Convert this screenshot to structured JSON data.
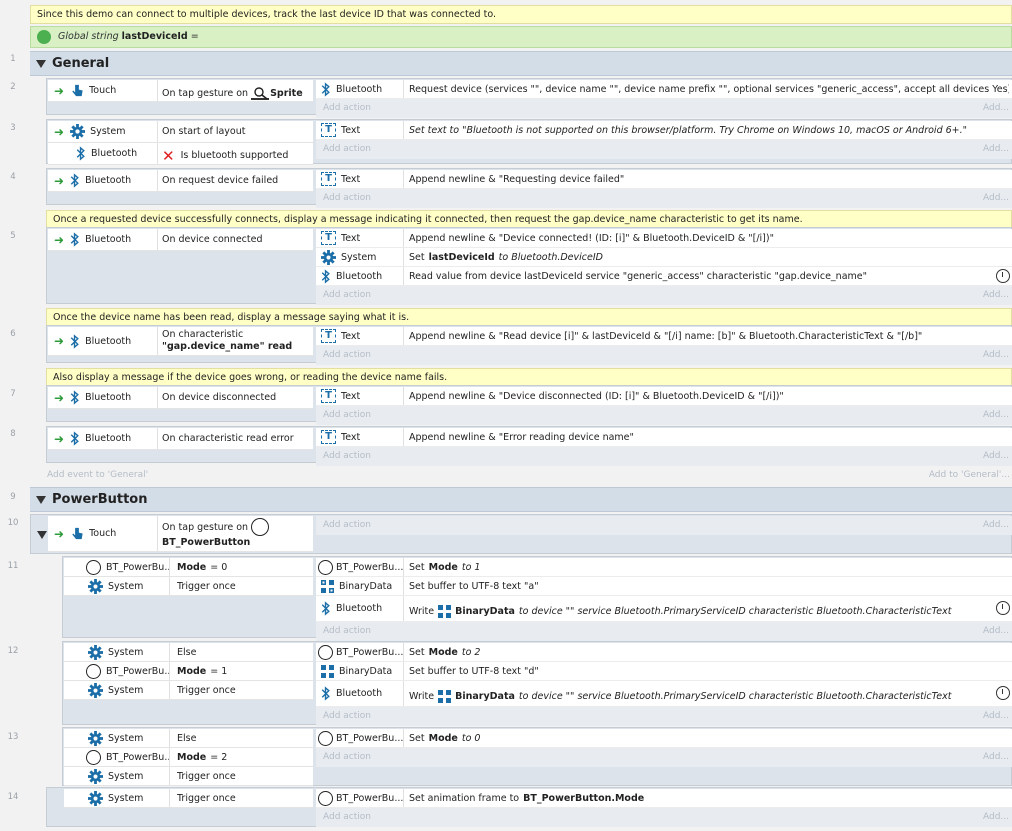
{
  "comments": {
    "c0": "Since this demo can connect to multiple devices, track the last device ID that was connected to.",
    "c5": "Once a requested device successfully connects, display a message indicating it connected, then request the gap.device_name characteristic to get its name.",
    "c6": "Once the device name has been read, display a message saying what it is.",
    "c7": "Also display a message if the device goes wrong, or reading the device name fails."
  },
  "global_var": {
    "prefix": "Global string",
    "name": "lastDeviceId",
    "suffix": "="
  },
  "line_numbers": [
    "1",
    "2",
    "3",
    "4",
    "5",
    "6",
    "7",
    "8",
    "9",
    "10",
    "11",
    "12",
    "13",
    "14"
  ],
  "groups": {
    "general": "General",
    "power": "PowerButton"
  },
  "objects": {
    "touch": "Touch",
    "bluetooth": "Bluetooth",
    "system": "System",
    "text": "Text",
    "bt_power": "BT_PowerBu...",
    "binary": "BinaryData"
  },
  "add_action": "Add action",
  "add_more": "Add...",
  "add_event": "Add event to 'General'",
  "add_to": "Add to 'General'...",
  "events": {
    "e2": {
      "cond": "On tap gesture on",
      "cond_obj": "Sprite",
      "action": "Request device (services \"\", device name \"\", device name prefix \"\", optional services \"generic_access\", accept all devices Yes)"
    },
    "e3": {
      "cond1": "On start of layout",
      "cond2": "Is bluetooth supported",
      "action": "Set text to \"Bluetooth is not supported on this browser/platform. Try Chrome on Windows 10, macOS or Android 6+.\""
    },
    "e4": {
      "cond": "On request device failed",
      "action": "Append newline & \"Requesting device failed\""
    },
    "e5": {
      "cond": "On device connected",
      "a1": "Append newline & \"Device connected! (ID: [i]\" & Bluetooth.DeviceID & \"[/i])\"",
      "a2_pre": "Set",
      "a2_var": "lastDeviceId",
      "a2_post": "to Bluetooth.DeviceID",
      "a3": "Read value from device lastDeviceId service \"generic_access\" characteristic \"gap.device_name\""
    },
    "e6": {
      "cond_a": "On characteristic",
      "cond_b": "\"gap.device_name\" read",
      "action": "Append newline & \"Read device [i]\" & lastDeviceId & \"[/i] name: [b]\" & Bluetooth.CharacteristicText & \"[/b]\""
    },
    "e7": {
      "cond": "On device disconnected",
      "action": "Append newline & \"Device disconnected (ID: [i]\" & Bluetooth.DeviceID & \"[/i])\""
    },
    "e8": {
      "cond": "On characteristic read error",
      "action": "Append newline & \"Error reading device name\""
    },
    "e10": {
      "cond_a": "On tap gesture on",
      "cond_b": "BT_PowerButton"
    },
    "e11": {
      "c1_var": "Mode",
      "c1_val": "= 0",
      "c2": "Trigger once",
      "a1_pre": "Set",
      "a1_var": "Mode",
      "a1_post": "to 1",
      "a2": "Set buffer to UTF-8 text \"a\"",
      "a3_pre": "Write",
      "a3_obj": "BinaryData",
      "a3_post": "to device \"\" service Bluetooth.PrimaryServiceID characteristic Bluetooth.CharacteristicText"
    },
    "e12": {
      "c1": "Else",
      "c2_var": "Mode",
      "c2_val": "= 1",
      "c3": "Trigger once",
      "a1_pre": "Set",
      "a1_var": "Mode",
      "a1_post": "to 2",
      "a2": "Set buffer to UTF-8 text \"d\"",
      "a3_pre": "Write",
      "a3_obj": "BinaryData",
      "a3_post": "to device \"\" service Bluetooth.PrimaryServiceID characteristic Bluetooth.CharacteristicText"
    },
    "e13": {
      "c1": "Else",
      "c2_var": "Mode",
      "c2_val": "= 2",
      "c3": "Trigger once",
      "a1_pre": "Set",
      "a1_var": "Mode",
      "a1_post": "to 0"
    },
    "e14": {
      "cond": "Trigger once",
      "a_pre": "Set animation frame to",
      "a_val": "BT_PowerButton.Mode"
    }
  },
  "colors": {
    "comment": "#ffffc6",
    "global": "#d8f0c4",
    "group": "#d3dde8",
    "accent": "#1b6ea8"
  }
}
